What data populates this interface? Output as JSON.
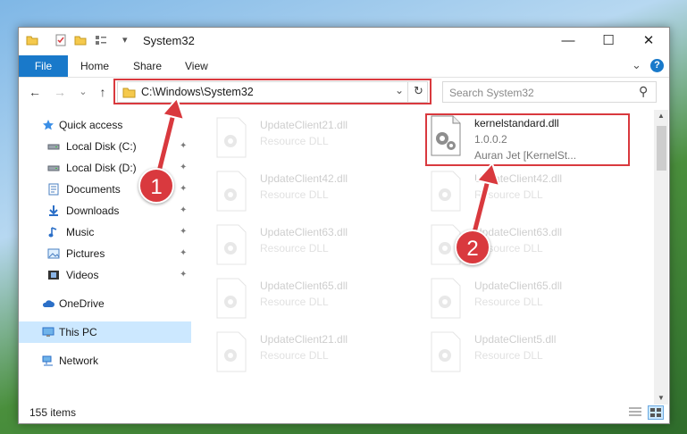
{
  "window": {
    "title": "System32",
    "min_symbol": "—",
    "max_symbol": "☐",
    "close_symbol": "✕"
  },
  "ribbon": {
    "tabs": [
      {
        "label": "File",
        "active": true
      },
      {
        "label": "Home"
      },
      {
        "label": "Share"
      },
      {
        "label": "View"
      }
    ],
    "expand_symbol": "⌄",
    "help_symbol": "?"
  },
  "nav": {
    "back_symbol": "←",
    "forward_symbol": "→",
    "recent_symbol": "⌄",
    "up_symbol": "↑",
    "address": "C:\\Windows\\System32",
    "address_dropdown_symbol": "⌄",
    "refresh_symbol": "↻",
    "search_placeholder": "Search System32",
    "search_symbol": "⚲"
  },
  "sidebar": {
    "items": [
      {
        "label": "Quick access",
        "icon": "star-icon",
        "pinned": false
      },
      {
        "label": "Local Disk (C:)",
        "icon": "drive-icon",
        "pinned": true
      },
      {
        "label": "Local Disk (D:)",
        "icon": "drive-icon",
        "pinned": true
      },
      {
        "label": "Documents",
        "icon": "documents-icon",
        "pinned": true
      },
      {
        "label": "Downloads",
        "icon": "download-icon",
        "pinned": true
      },
      {
        "label": "Music",
        "icon": "music-icon",
        "pinned": true
      },
      {
        "label": "Pictures",
        "icon": "pictures-icon",
        "pinned": true
      },
      {
        "label": "Videos",
        "icon": "videos-icon",
        "pinned": true
      },
      {
        "label": "OneDrive",
        "icon": "cloud-icon",
        "pinned": false
      },
      {
        "label": "This PC",
        "icon": "computer-icon",
        "pinned": false,
        "selected": true
      },
      {
        "label": "Network",
        "icon": "network-icon",
        "pinned": false
      }
    ],
    "pin_symbol": "📌"
  },
  "files": {
    "left_column": [
      {
        "name": "UpdateClient21.dll",
        "desc": "Resource DLL"
      },
      {
        "name": "UpdateClient42.dll",
        "desc": "Resource DLL"
      },
      {
        "name": "UpdateClient63.dll",
        "desc": "Resource DLL"
      },
      {
        "name": "UpdateClient65.dll",
        "desc": "Resource DLL"
      },
      {
        "name": "UpdateClient21.dll",
        "desc": "Resource DLL"
      }
    ],
    "right_column": [
      {
        "name": "UpdateClient42.dll",
        "desc": "Resource DLL"
      },
      {
        "name": "UpdateClient63.dll",
        "desc": "Resource DLL"
      },
      {
        "name": "UpdateClient65.dll",
        "desc": "Resource DLL"
      },
      {
        "name": "UpdateClient5.dll",
        "desc": "Resource DLL"
      }
    ],
    "highlighted": {
      "name": "kernelstandard.dll",
      "version": "1.0.0.2",
      "company": "Auran Jet [KernelSt..."
    }
  },
  "status": {
    "item_count": "155 items"
  },
  "callouts": {
    "one": "1",
    "two": "2"
  },
  "colors": {
    "accent": "#1979ca",
    "highlight": "#d9393e",
    "selection": "#cce8ff"
  }
}
